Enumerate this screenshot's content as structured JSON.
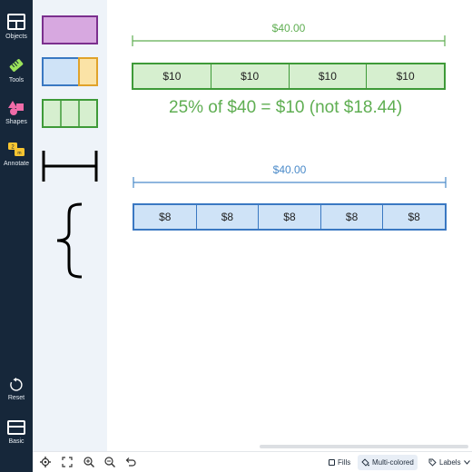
{
  "rail": {
    "objects": "Objects",
    "tools": "Tools",
    "shapes": "Shapes",
    "annotate": "Annotate",
    "reset": "Reset",
    "basic": "Basic"
  },
  "model_green": {
    "total": "$40.00",
    "segments": [
      "$10",
      "$10",
      "$10",
      "$10"
    ],
    "caption": "25% of $40 = $10 (not $18.44)"
  },
  "model_blue": {
    "total": "$40.00",
    "segments": [
      "$8",
      "$8",
      "$8",
      "$8",
      "$8"
    ]
  },
  "toolbar": {
    "fills": "Fills",
    "multicolored": "Multi-colored",
    "labels": "Labels"
  },
  "colors": {
    "rail_bg": "#16273a",
    "palette_bg": "#eef3f9",
    "green_fill": "#d6efcf",
    "green_stroke": "#3e9a38",
    "green_text": "#5fae52",
    "blue_fill": "#cfe3f7",
    "blue_stroke": "#3a78c2",
    "blue_text": "#4a8ac9",
    "purple_fill": "#d7a8e0",
    "purple_stroke": "#7b2f8e",
    "orange_fill": "#fbe3a6",
    "orange_stroke": "#e0a22a"
  }
}
